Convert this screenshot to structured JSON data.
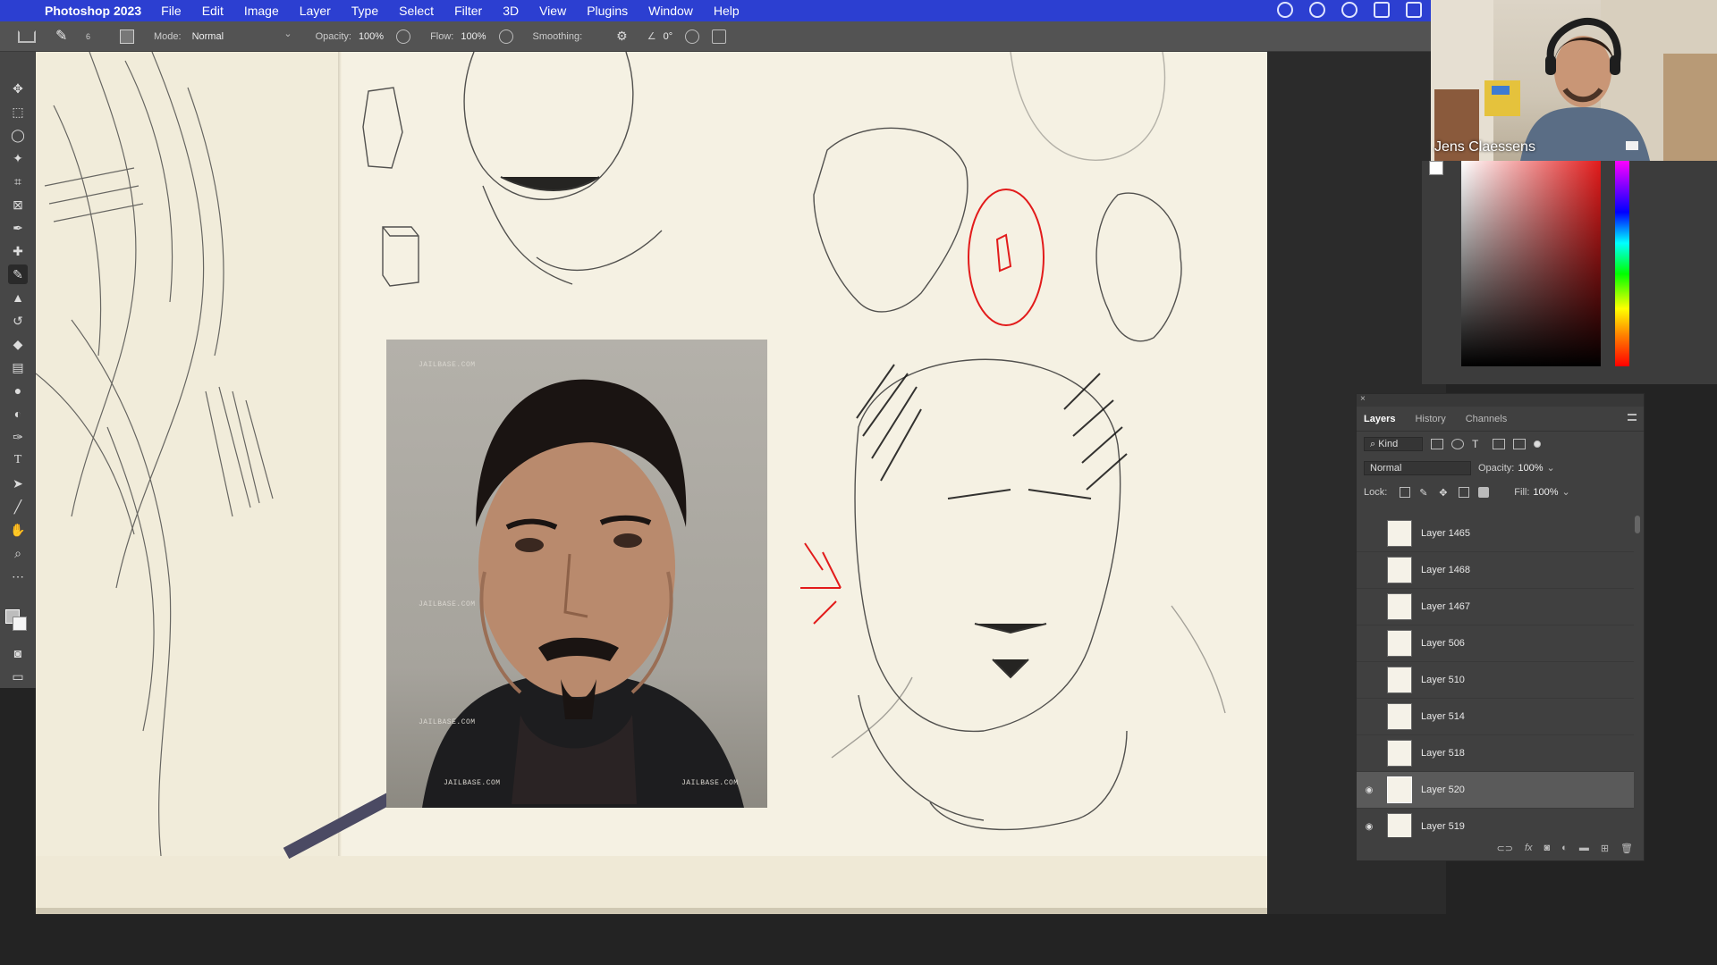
{
  "menubar": {
    "app_name": "Photoshop 2023",
    "items": [
      "File",
      "Edit",
      "Image",
      "Layer",
      "Type",
      "Select",
      "Filter",
      "3D",
      "View",
      "Plugins",
      "Window",
      "Help"
    ]
  },
  "options": {
    "brush_size": "6",
    "mode_label": "Mode:",
    "mode_value": "Normal",
    "opacity_label": "Opacity:",
    "opacity_value": "100%",
    "flow_label": "Flow:",
    "flow_value": "100%",
    "smoothing_label": "Smoothing:",
    "angle_value": "0°"
  },
  "webcam": {
    "name": "Jens Claessens"
  },
  "photo": {
    "watermarks": [
      "JAILBASE.COM",
      "JAILBASE.COM",
      "JAILBASE.COM",
      "JAILBASE.COM",
      "JAILBASE.COM"
    ]
  },
  "layers_panel": {
    "tabs": [
      "Layers",
      "History",
      "Channels"
    ],
    "filter_kind": "Kind",
    "blend_mode": "Normal",
    "opacity_label": "Opacity:",
    "opacity_value": "100%",
    "lock_label": "Lock:",
    "fill_label": "Fill:",
    "fill_value": "100%",
    "layers": [
      {
        "name": "Layer 1465",
        "visible": false,
        "selected": false
      },
      {
        "name": "Layer 1468",
        "visible": false,
        "selected": false
      },
      {
        "name": "Layer 1467",
        "visible": false,
        "selected": false
      },
      {
        "name": "Layer 506",
        "visible": false,
        "selected": false
      },
      {
        "name": "Layer 510",
        "visible": false,
        "selected": false
      },
      {
        "name": "Layer 514",
        "visible": false,
        "selected": false
      },
      {
        "name": "Layer 518",
        "visible": false,
        "selected": false
      },
      {
        "name": "Layer 520",
        "visible": true,
        "selected": true
      },
      {
        "name": "Layer 519",
        "visible": true,
        "selected": false
      }
    ]
  },
  "colors": {
    "menubar": "#2c3fd1",
    "panel": "#404040",
    "paper": "#f5f1e3",
    "accent_red": "#e21b1b"
  }
}
